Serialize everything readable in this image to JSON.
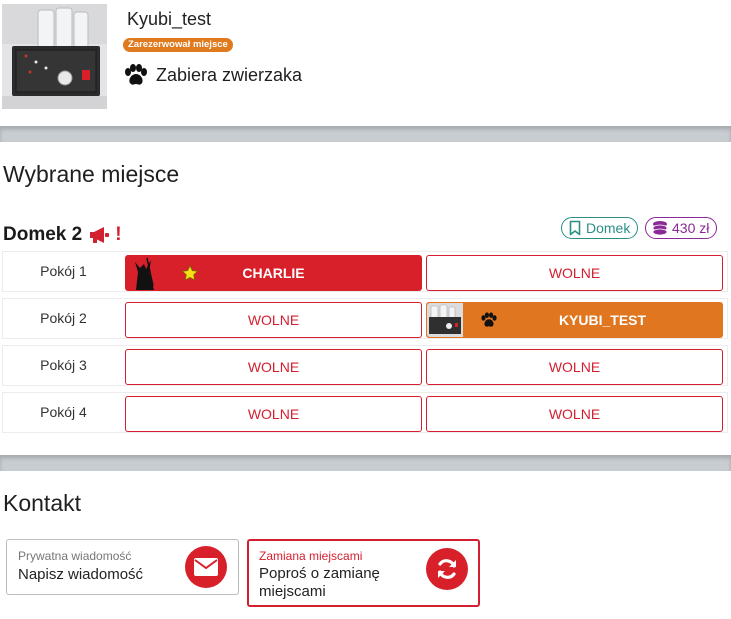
{
  "header": {
    "username": "Kyubi_test",
    "reserved_badge": "Zarezerwował miejsce",
    "pet_text": "Zabiera zwierzaka"
  },
  "selected_place": {
    "title": "Wybrane miejsce",
    "house_name": "Domek 2",
    "alert_mark": "!",
    "type_chip": "Domek",
    "price_chip": "430 zł",
    "rooms": [
      {
        "label": "Pokój 1",
        "slots": [
          {
            "text": "CHARLIE",
            "status": "taken",
            "icon": "star-icon"
          },
          {
            "text": "WOLNE",
            "status": "free"
          }
        ]
      },
      {
        "label": "Pokój 2",
        "slots": [
          {
            "text": "WOLNE",
            "status": "free"
          },
          {
            "text": "KYUBI_TEST",
            "status": "taken",
            "icon": "paw-icon"
          }
        ]
      },
      {
        "label": "Pokój 3",
        "slots": [
          {
            "text": "WOLNE",
            "status": "free"
          },
          {
            "text": "WOLNE",
            "status": "free"
          }
        ]
      },
      {
        "label": "Pokój 4",
        "slots": [
          {
            "text": "WOLNE",
            "status": "free"
          },
          {
            "text": "WOLNE",
            "status": "free"
          }
        ]
      }
    ]
  },
  "contact": {
    "title": "Kontakt",
    "message_card": {
      "label": "Prywatna wiadomość",
      "value": "Napisz wiadomość",
      "icon": "envelope-icon"
    },
    "swap_card": {
      "label": "Zamiana miejscami",
      "value": "Poproś o zamianę miejscami",
      "icon": "sync-icon"
    }
  },
  "colors": {
    "accent_red": "#d7202a",
    "reserved_orange": "#e0761f",
    "type_chip": "#2c8f85",
    "price_chip": "#8a2a96",
    "divider": "#c7cdd1"
  }
}
